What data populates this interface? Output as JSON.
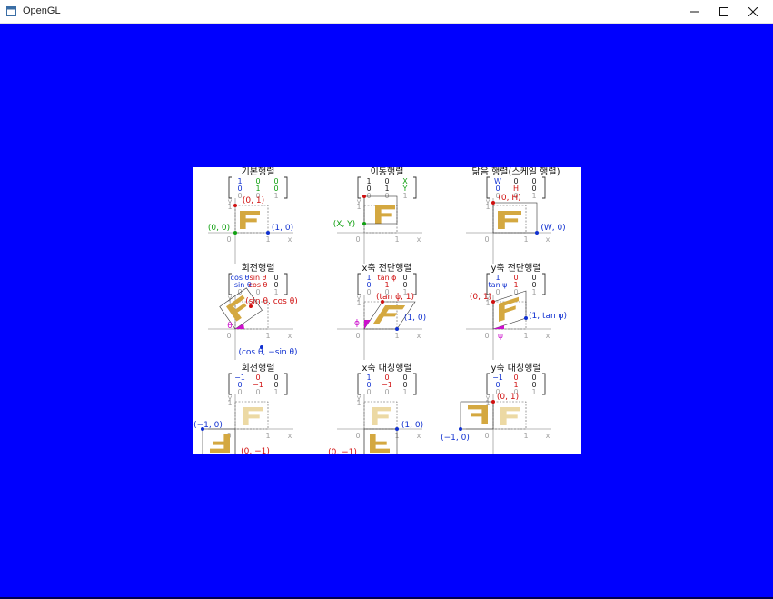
{
  "window": {
    "title": "OpenGL",
    "icon": "window-app-icon",
    "controls": [
      "minimize-icon",
      "maximize-icon",
      "close-icon"
    ]
  },
  "colors": {
    "client_background": "#0000fe",
    "figure_background": "#ffffff",
    "red": "#d01010",
    "blue": "#1030d0",
    "green": "#10a010",
    "magenta": "#cc10cc",
    "gold": "#d4a840",
    "gold_light": "#ecd9a4",
    "axis_gray": "#a0a0a0"
  },
  "panels": [
    {
      "title": "기본행렬",
      "matrix": [
        [
          "1",
          "0",
          "0"
        ],
        [
          "0",
          "1",
          "0"
        ],
        [
          "0",
          "0",
          "1"
        ]
      ],
      "labels": [
        "(0, 1)",
        "(0, 0)",
        "(1, 0)"
      ]
    },
    {
      "title": "이동행렬",
      "matrix": [
        [
          "1",
          "0",
          "X"
        ],
        [
          "0",
          "1",
          "Y"
        ],
        [
          "0",
          "0",
          "1"
        ]
      ],
      "labels": [
        "(X, Y)"
      ]
    },
    {
      "title": "닮음 행렬(스케일 행렬)",
      "matrix": [
        [
          "W",
          "0",
          "0"
        ],
        [
          "0",
          "H",
          "0"
        ],
        [
          "0",
          "0",
          "1"
        ]
      ],
      "labels": [
        "(0, H)",
        "(W, 0)"
      ]
    },
    {
      "title": "회전행렬",
      "matrix": [
        [
          "cos θ",
          "sin θ",
          "0"
        ],
        [
          "−sin θ",
          "cos θ",
          "0"
        ],
        [
          "0",
          "0",
          "1"
        ]
      ],
      "labels": [
        "(sin θ, cos θ)",
        "(cos θ, −sin θ)",
        "θ"
      ]
    },
    {
      "title": "x축 전단행렬",
      "matrix": [
        [
          "1",
          "tan ϕ",
          "0"
        ],
        [
          "0",
          "1",
          "0"
        ],
        [
          "0",
          "0",
          "1"
        ]
      ],
      "labels": [
        "(tan ϕ, 1)",
        "(1, 0)",
        "ϕ"
      ]
    },
    {
      "title": "y축 전단행렬",
      "matrix": [
        [
          "1",
          "0",
          "0"
        ],
        [
          "tan ψ",
          "1",
          "0"
        ],
        [
          "0",
          "0",
          "1"
        ]
      ],
      "labels": [
        "(0, 1)",
        "(1, tan ψ)",
        "ψ"
      ]
    },
    {
      "title": "회전행렬",
      "matrix": [
        [
          "−1",
          "0",
          "0"
        ],
        [
          "0",
          "−1",
          "0"
        ],
        [
          "0",
          "0",
          "1"
        ]
      ],
      "labels": [
        "(−1, 0)",
        "(0, −1)"
      ]
    },
    {
      "title": "x축 대칭행렬",
      "matrix": [
        [
          "1",
          "0",
          "0"
        ],
        [
          "0",
          "−1",
          "0"
        ],
        [
          "0",
          "0",
          "1"
        ]
      ],
      "labels": [
        "(1, 0)",
        "(0, −1)"
      ]
    },
    {
      "title": "y축 대칭행렬",
      "matrix": [
        [
          "−1",
          "0",
          "0"
        ],
        [
          "0",
          "1",
          "0"
        ],
        [
          "0",
          "0",
          "1"
        ]
      ],
      "labels": [
        "(0, 1)",
        "(−1, 0)"
      ]
    }
  ],
  "axis_text": {
    "x": "x",
    "y": "y",
    "zero": "0",
    "one": "1"
  }
}
